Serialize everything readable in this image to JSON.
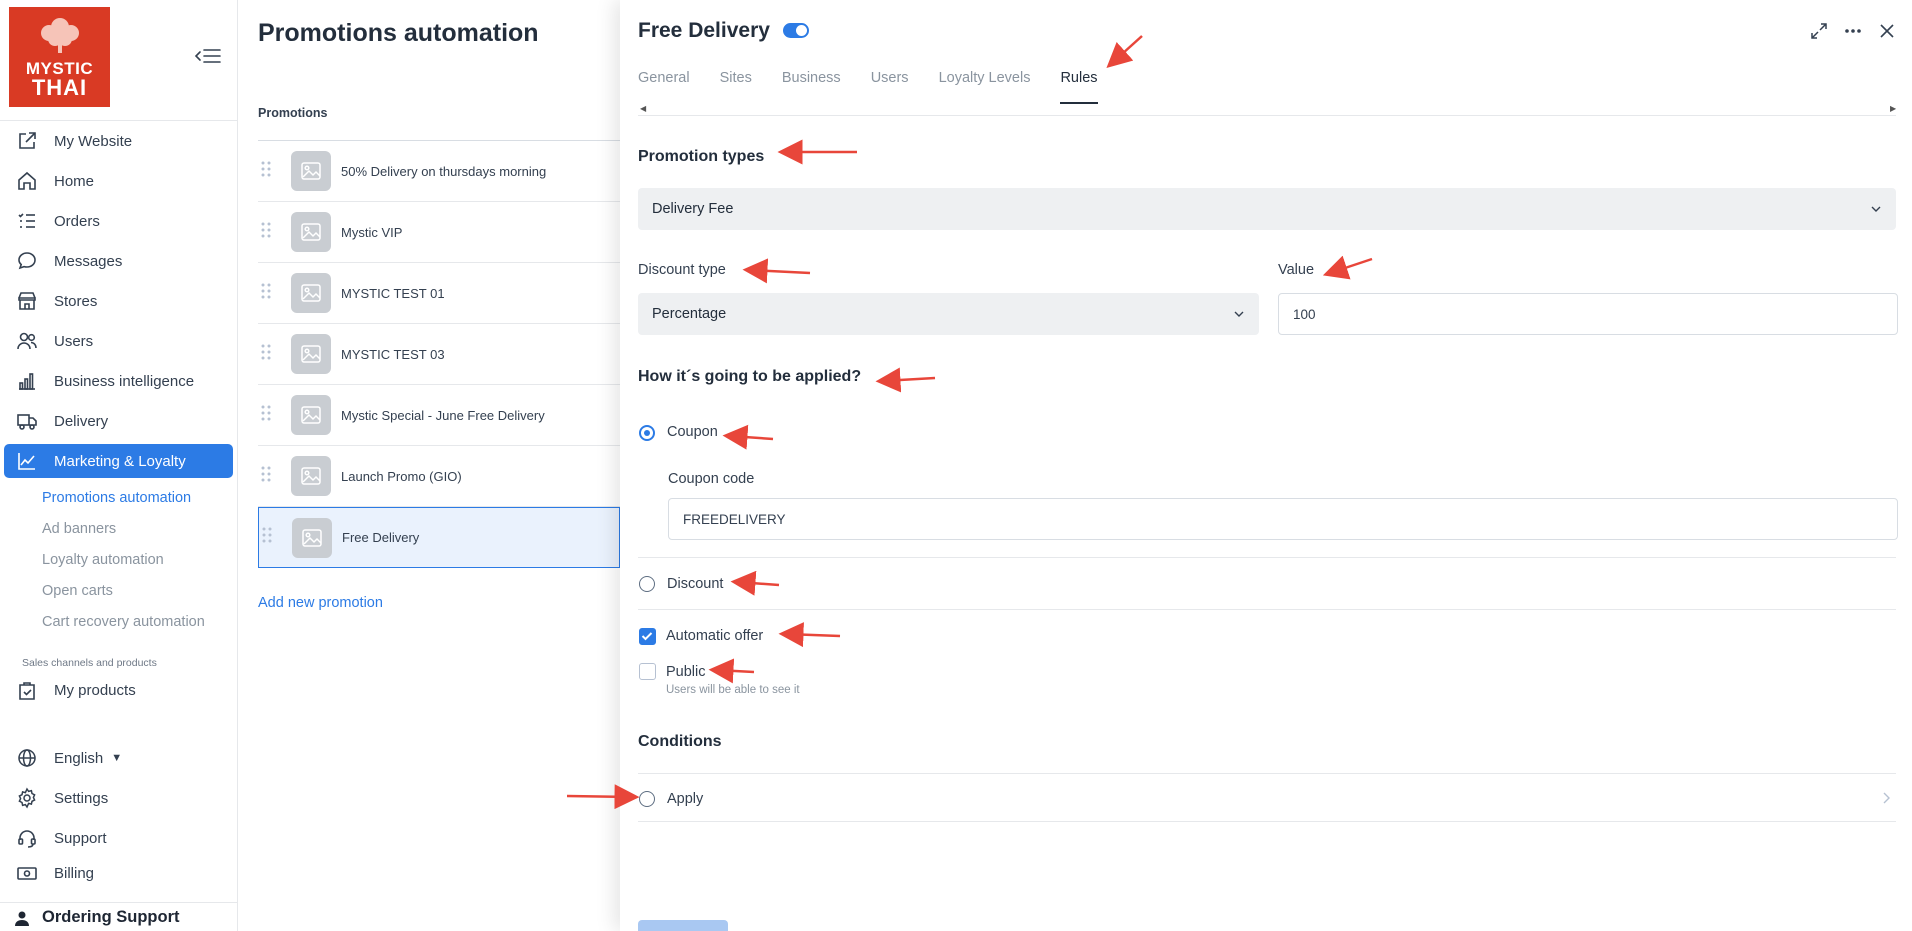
{
  "sidebar": {
    "logo": {
      "line1": "MYSTIC",
      "line2": "THAI"
    },
    "nav": [
      {
        "label": "My Website",
        "icon": "external-link-icon"
      },
      {
        "label": "Home",
        "icon": "home-icon"
      },
      {
        "label": "Orders",
        "icon": "list-icon"
      },
      {
        "label": "Messages",
        "icon": "chat-icon"
      },
      {
        "label": "Stores",
        "icon": "store-icon"
      },
      {
        "label": "Users",
        "icon": "users-icon"
      },
      {
        "label": "Business intelligence",
        "icon": "bar-chart-icon"
      },
      {
        "label": "Delivery",
        "icon": "truck-icon"
      },
      {
        "label": "Marketing & Loyalty",
        "icon": "trend-chart-icon"
      }
    ],
    "subnav": [
      {
        "label": "Promotions automation"
      },
      {
        "label": "Ad banners"
      },
      {
        "label": "Loyalty automation"
      },
      {
        "label": "Open carts"
      },
      {
        "label": "Cart recovery automation"
      }
    ],
    "section_caption": "Sales channels and products",
    "my_products": "My products",
    "language": "English",
    "settings": "Settings",
    "support": "Support",
    "billing": "Billing",
    "account": "Ordering Support"
  },
  "middle": {
    "title": "Promotions automation",
    "list_header": "Promotions",
    "promotions": [
      "50% Delivery on thursdays morning",
      "Mystic VIP",
      "MYSTIC TEST 01",
      "MYSTIC TEST 03",
      "Mystic Special - June Free Delivery",
      "Launch Promo (GIO)",
      "Free Delivery"
    ],
    "add_label": "Add new promotion"
  },
  "panel": {
    "title": "Free Delivery",
    "enabled": true,
    "tabs": [
      "General",
      "Sites",
      "Business",
      "Users",
      "Loyalty Levels",
      "Rules"
    ],
    "active_tab": "Rules",
    "promotion_types_title": "Promotion types",
    "promotion_type_value": "Delivery Fee",
    "discount_type_label": "Discount type",
    "discount_type_value": "Percentage",
    "value_label": "Value",
    "value": "100",
    "applied_title": "How it´s going to be applied?",
    "coupon_label": "Coupon",
    "coupon_code_label": "Coupon code",
    "coupon_code_value": "FREEDELIVERY",
    "discount_label": "Discount",
    "automatic_offer_label": "Automatic offer",
    "public_label": "Public",
    "public_hint": "Users will be able to see it",
    "conditions_title": "Conditions",
    "apply_label": "Apply"
  },
  "colors": {
    "accent": "#2c7be5",
    "annotation_arrow": "#e8463a",
    "logo_bg": "#d93a24"
  }
}
